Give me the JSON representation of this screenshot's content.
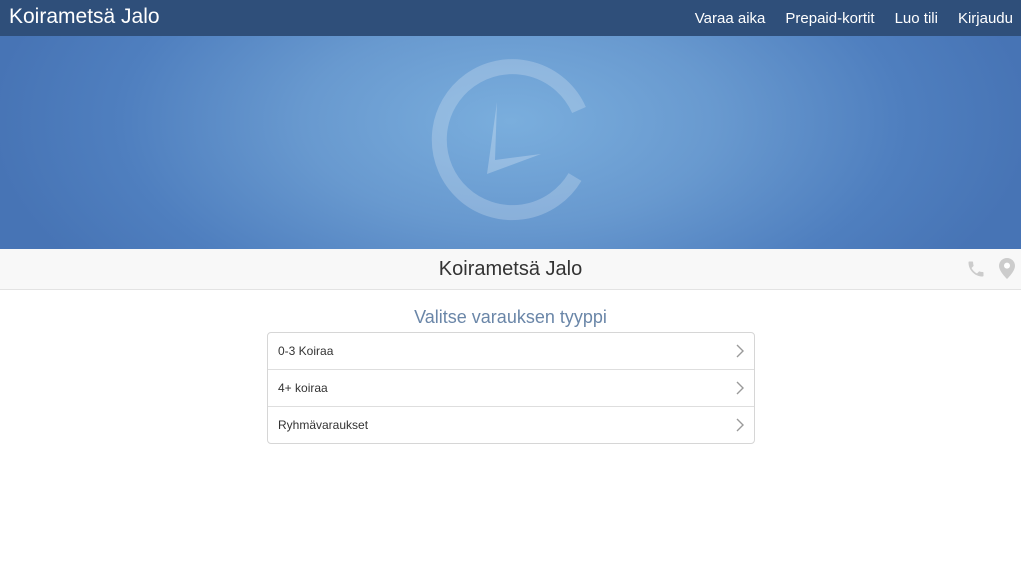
{
  "navbar": {
    "brand": "Koirametsä Jalo",
    "links": [
      "Varaa aika",
      "Prepaid-kortit",
      "Luo tili",
      "Kirjaudu"
    ]
  },
  "hero": {
    "logo_icon": "clock-logo-icon"
  },
  "title_bar": {
    "title": "Koirametsä Jalo",
    "icons": [
      "phone-icon",
      "map-pin-icon"
    ]
  },
  "main": {
    "heading": "Valitse varauksen tyyppi",
    "items": [
      {
        "label": "0-3 Koiraa"
      },
      {
        "label": "4+ koiraa"
      },
      {
        "label": "Ryhmävaraukset"
      }
    ]
  },
  "colors": {
    "navbar_bg": "#2f4f7a",
    "hero_bg": "#6899cf",
    "heading_text": "#6a86a8",
    "icon_gray": "#cccccc"
  }
}
